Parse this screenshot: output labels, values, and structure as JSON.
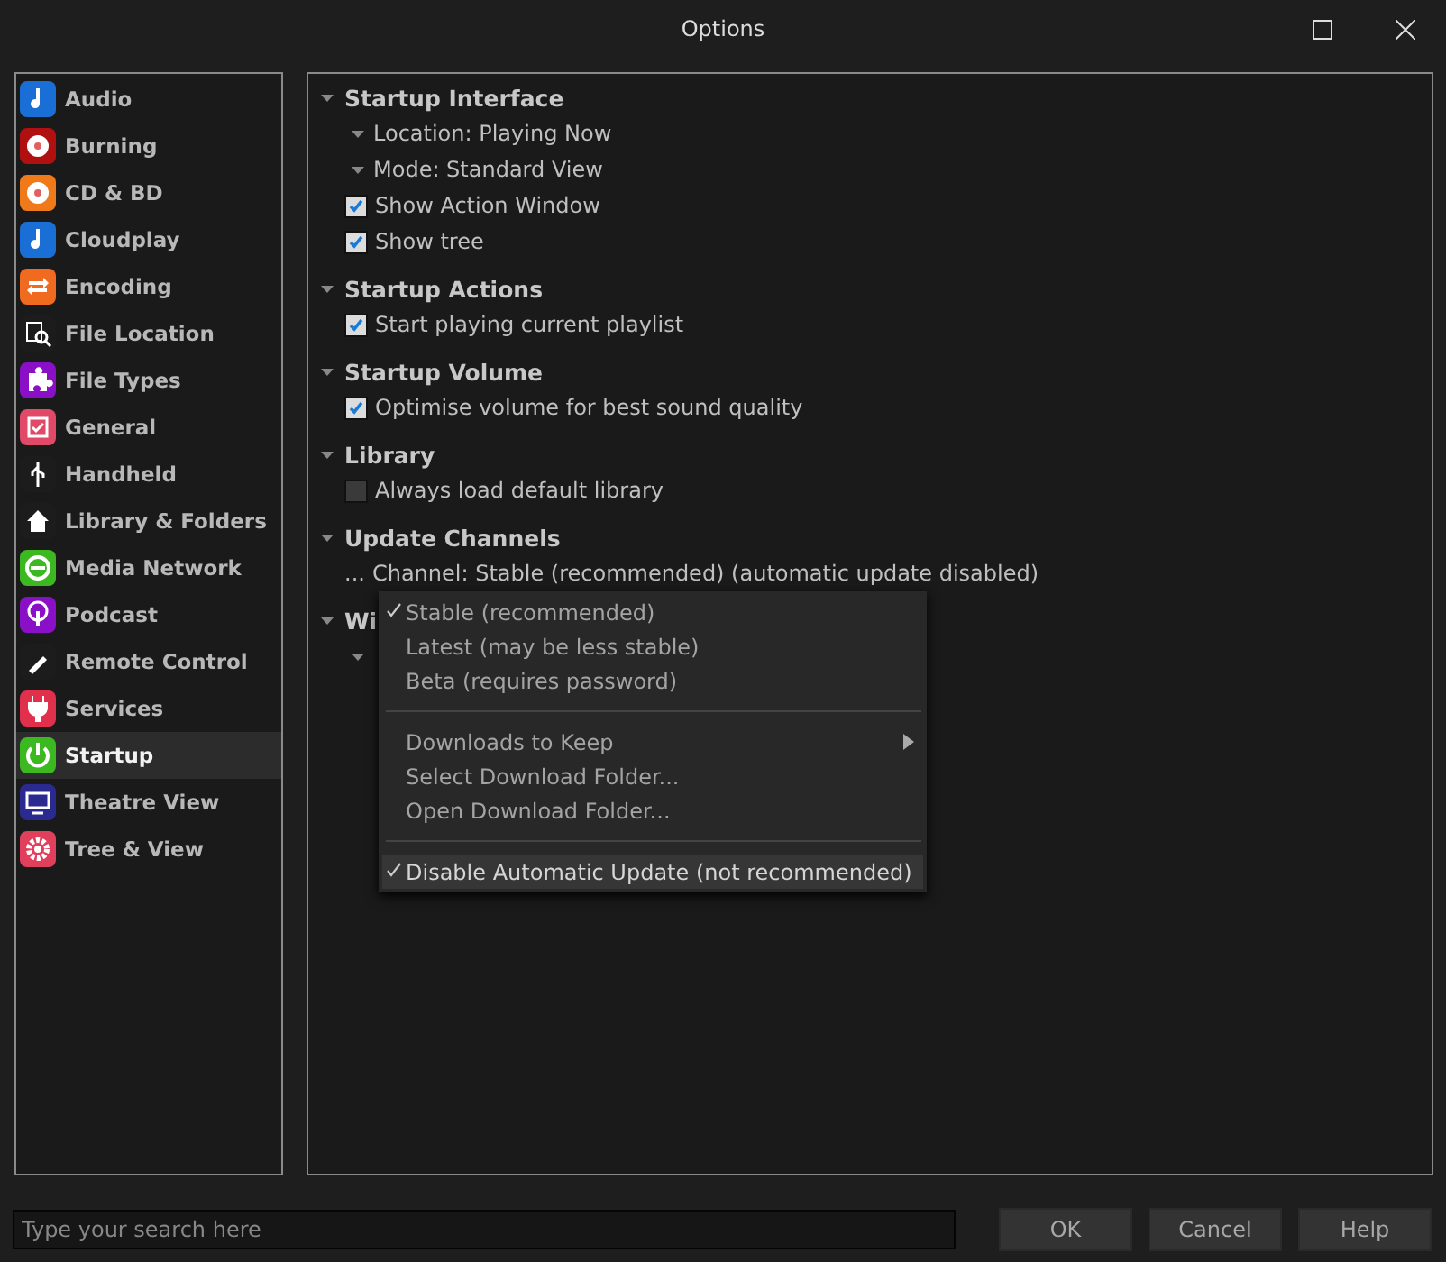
{
  "window": {
    "title": "Options"
  },
  "sidebar": {
    "items": [
      {
        "label": "Audio",
        "color": "#1a6fd6",
        "selected": false
      },
      {
        "label": "Burning",
        "color": "#b01010",
        "selected": false
      },
      {
        "label": "CD & BD",
        "color": "#f07a1a",
        "selected": false
      },
      {
        "label": "Cloudplay",
        "color": "#1a6fd6",
        "selected": false
      },
      {
        "label": "Encoding",
        "color": "#f06a20",
        "selected": false
      },
      {
        "label": "File Location",
        "color": "#1c1c1c",
        "selected": false
      },
      {
        "label": "File Types",
        "color": "#8a10c8",
        "selected": false
      },
      {
        "label": "General",
        "color": "#e04a68",
        "selected": false
      },
      {
        "label": "Handheld",
        "color": "#1c1c1c",
        "selected": false
      },
      {
        "label": "Library & Folders",
        "color": "#1c1c1c",
        "selected": false
      },
      {
        "label": "Media Network",
        "color": "#3cb820",
        "selected": false
      },
      {
        "label": "Podcast",
        "color": "#8a10c8",
        "selected": false
      },
      {
        "label": "Remote Control",
        "color": "#1c1c1c",
        "selected": false
      },
      {
        "label": "Services",
        "color": "#e0304c",
        "selected": false
      },
      {
        "label": "Startup",
        "color": "#3cb820",
        "selected": true
      },
      {
        "label": "Theatre View",
        "color": "#2a2a90",
        "selected": false
      },
      {
        "label": "Tree & View",
        "color": "#e0405c",
        "selected": false
      }
    ]
  },
  "tree": [
    {
      "label": "Startup Interface",
      "expanded": true,
      "children": [
        {
          "kind": "dropdown",
          "label": "Location: Playing Now"
        },
        {
          "kind": "dropdown",
          "label": "Mode: Standard View"
        },
        {
          "kind": "checkbox",
          "label": "Show Action Window",
          "checked": true
        },
        {
          "kind": "checkbox",
          "label": "Show tree",
          "checked": true
        }
      ]
    },
    {
      "label": "Startup Actions",
      "expanded": true,
      "children": [
        {
          "kind": "checkbox",
          "label": "Start playing current playlist",
          "checked": true
        }
      ]
    },
    {
      "label": "Startup Volume",
      "expanded": true,
      "children": [
        {
          "kind": "checkbox",
          "label": "Optimise volume for best sound quality",
          "checked": true
        }
      ]
    },
    {
      "label": "Library",
      "expanded": true,
      "children": [
        {
          "kind": "checkbox",
          "label": "Always load default library",
          "checked": false
        }
      ]
    },
    {
      "label": "Update Channels",
      "expanded": true,
      "children": [
        {
          "kind": "ellipsis",
          "marker": "...",
          "label": "Channel: Stable (recommended) (automatic update disabled)"
        }
      ]
    },
    {
      "label": "Wi",
      "expanded": true,
      "children": [
        {
          "kind": "dropdown"
        }
      ]
    }
  ],
  "menu": {
    "items": [
      {
        "kind": "item",
        "label": "Stable (recommended)",
        "checked": true,
        "highlighted": false
      },
      {
        "kind": "item",
        "label": "Latest (may be less stable)",
        "checked": false,
        "highlighted": false
      },
      {
        "kind": "item",
        "label": "Beta (requires password)",
        "checked": false,
        "highlighted": false
      },
      {
        "kind": "separator"
      },
      {
        "kind": "submenu",
        "label": "Downloads to Keep",
        "highlighted": false
      },
      {
        "kind": "item",
        "label": "Select Download Folder...",
        "checked": false,
        "highlighted": false
      },
      {
        "kind": "item",
        "label": "Open Download Folder...",
        "checked": false,
        "highlighted": false
      },
      {
        "kind": "separator"
      },
      {
        "kind": "item",
        "label": "Disable Automatic Update (not recommended)",
        "checked": true,
        "highlighted": true
      }
    ]
  },
  "search": {
    "placeholder": "Type your search here"
  },
  "buttons": [
    "OK",
    "Cancel",
    "Help"
  ]
}
